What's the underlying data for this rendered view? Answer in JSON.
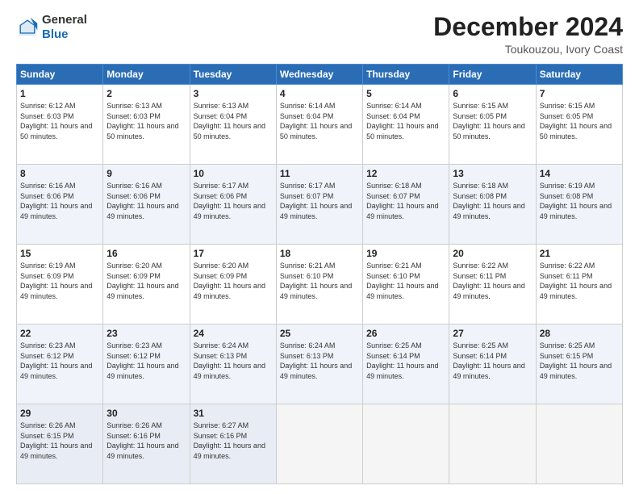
{
  "header": {
    "logo": {
      "general": "General",
      "blue": "Blue"
    },
    "title": "December 2024",
    "location": "Toukouzou, Ivory Coast"
  },
  "days_of_week": [
    "Sunday",
    "Monday",
    "Tuesday",
    "Wednesday",
    "Thursday",
    "Friday",
    "Saturday"
  ],
  "weeks": [
    [
      {
        "day": "1",
        "sunrise": "6:12 AM",
        "sunset": "6:03 PM",
        "daylight": "11 hours and 50 minutes."
      },
      {
        "day": "2",
        "sunrise": "6:13 AM",
        "sunset": "6:03 PM",
        "daylight": "11 hours and 50 minutes."
      },
      {
        "day": "3",
        "sunrise": "6:13 AM",
        "sunset": "6:04 PM",
        "daylight": "11 hours and 50 minutes."
      },
      {
        "day": "4",
        "sunrise": "6:14 AM",
        "sunset": "6:04 PM",
        "daylight": "11 hours and 50 minutes."
      },
      {
        "day": "5",
        "sunrise": "6:14 AM",
        "sunset": "6:04 PM",
        "daylight": "11 hours and 50 minutes."
      },
      {
        "day": "6",
        "sunrise": "6:15 AM",
        "sunset": "6:05 PM",
        "daylight": "11 hours and 50 minutes."
      },
      {
        "day": "7",
        "sunrise": "6:15 AM",
        "sunset": "6:05 PM",
        "daylight": "11 hours and 50 minutes."
      }
    ],
    [
      {
        "day": "8",
        "sunrise": "6:16 AM",
        "sunset": "6:06 PM",
        "daylight": "11 hours and 49 minutes."
      },
      {
        "day": "9",
        "sunrise": "6:16 AM",
        "sunset": "6:06 PM",
        "daylight": "11 hours and 49 minutes."
      },
      {
        "day": "10",
        "sunrise": "6:17 AM",
        "sunset": "6:06 PM",
        "daylight": "11 hours and 49 minutes."
      },
      {
        "day": "11",
        "sunrise": "6:17 AM",
        "sunset": "6:07 PM",
        "daylight": "11 hours and 49 minutes."
      },
      {
        "day": "12",
        "sunrise": "6:18 AM",
        "sunset": "6:07 PM",
        "daylight": "11 hours and 49 minutes."
      },
      {
        "day": "13",
        "sunrise": "6:18 AM",
        "sunset": "6:08 PM",
        "daylight": "11 hours and 49 minutes."
      },
      {
        "day": "14",
        "sunrise": "6:19 AM",
        "sunset": "6:08 PM",
        "daylight": "11 hours and 49 minutes."
      }
    ],
    [
      {
        "day": "15",
        "sunrise": "6:19 AM",
        "sunset": "6:09 PM",
        "daylight": "11 hours and 49 minutes."
      },
      {
        "day": "16",
        "sunrise": "6:20 AM",
        "sunset": "6:09 PM",
        "daylight": "11 hours and 49 minutes."
      },
      {
        "day": "17",
        "sunrise": "6:20 AM",
        "sunset": "6:09 PM",
        "daylight": "11 hours and 49 minutes."
      },
      {
        "day": "18",
        "sunrise": "6:21 AM",
        "sunset": "6:10 PM",
        "daylight": "11 hours and 49 minutes."
      },
      {
        "day": "19",
        "sunrise": "6:21 AM",
        "sunset": "6:10 PM",
        "daylight": "11 hours and 49 minutes."
      },
      {
        "day": "20",
        "sunrise": "6:22 AM",
        "sunset": "6:11 PM",
        "daylight": "11 hours and 49 minutes."
      },
      {
        "day": "21",
        "sunrise": "6:22 AM",
        "sunset": "6:11 PM",
        "daylight": "11 hours and 49 minutes."
      }
    ],
    [
      {
        "day": "22",
        "sunrise": "6:23 AM",
        "sunset": "6:12 PM",
        "daylight": "11 hours and 49 minutes."
      },
      {
        "day": "23",
        "sunrise": "6:23 AM",
        "sunset": "6:12 PM",
        "daylight": "11 hours and 49 minutes."
      },
      {
        "day": "24",
        "sunrise": "6:24 AM",
        "sunset": "6:13 PM",
        "daylight": "11 hours and 49 minutes."
      },
      {
        "day": "25",
        "sunrise": "6:24 AM",
        "sunset": "6:13 PM",
        "daylight": "11 hours and 49 minutes."
      },
      {
        "day": "26",
        "sunrise": "6:25 AM",
        "sunset": "6:14 PM",
        "daylight": "11 hours and 49 minutes."
      },
      {
        "day": "27",
        "sunrise": "6:25 AM",
        "sunset": "6:14 PM",
        "daylight": "11 hours and 49 minutes."
      },
      {
        "day": "28",
        "sunrise": "6:25 AM",
        "sunset": "6:15 PM",
        "daylight": "11 hours and 49 minutes."
      }
    ],
    [
      {
        "day": "29",
        "sunrise": "6:26 AM",
        "sunset": "6:15 PM",
        "daylight": "11 hours and 49 minutes."
      },
      {
        "day": "30",
        "sunrise": "6:26 AM",
        "sunset": "6:16 PM",
        "daylight": "11 hours and 49 minutes."
      },
      {
        "day": "31",
        "sunrise": "6:27 AM",
        "sunset": "6:16 PM",
        "daylight": "11 hours and 49 minutes."
      },
      null,
      null,
      null,
      null
    ]
  ]
}
